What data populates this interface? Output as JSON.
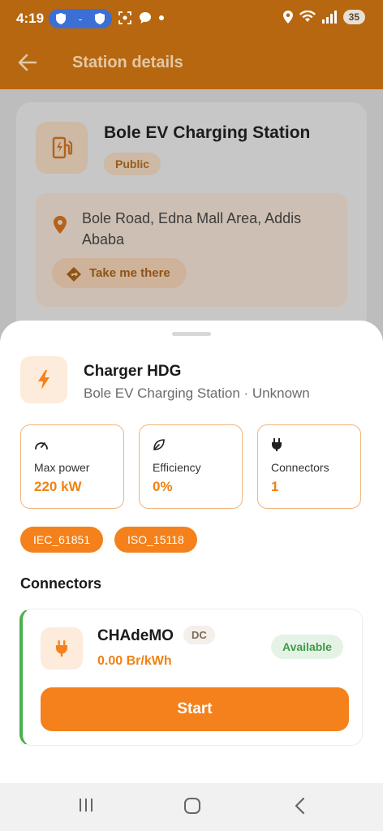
{
  "status_bar": {
    "time": "4:19",
    "vpn_dash": "-",
    "battery": "35"
  },
  "app_bar": {
    "title": "Station details",
    "back_icon": "back-arrow-icon"
  },
  "station": {
    "name": "Bole EV Charging Station",
    "access": "Public",
    "address": "Bole Road, Edna Mall Area, Addis Ababa",
    "directions_label": "Take me there"
  },
  "charger": {
    "name": "Charger HDG",
    "subtitle": "Bole EV Charging Station · Unknown",
    "stats": [
      {
        "label": "Max power",
        "value": "220 kW",
        "icon": "speedometer-icon"
      },
      {
        "label": "Efficiency",
        "value": "0%",
        "icon": "leaf-icon"
      },
      {
        "label": "Connectors",
        "value": "1",
        "icon": "plug-icon"
      }
    ],
    "standards": [
      "IEC_61851",
      "ISO_15118"
    ]
  },
  "connectors_section": {
    "title": "Connectors",
    "items": [
      {
        "name": "CHAdeMO",
        "type": "DC",
        "price": "0.00 Br/kWh",
        "status": "Available",
        "action_label": "Start"
      }
    ]
  },
  "colors": {
    "primary": "#f4811b",
    "app_bar": "#b76710",
    "available": "#3f9b48"
  }
}
